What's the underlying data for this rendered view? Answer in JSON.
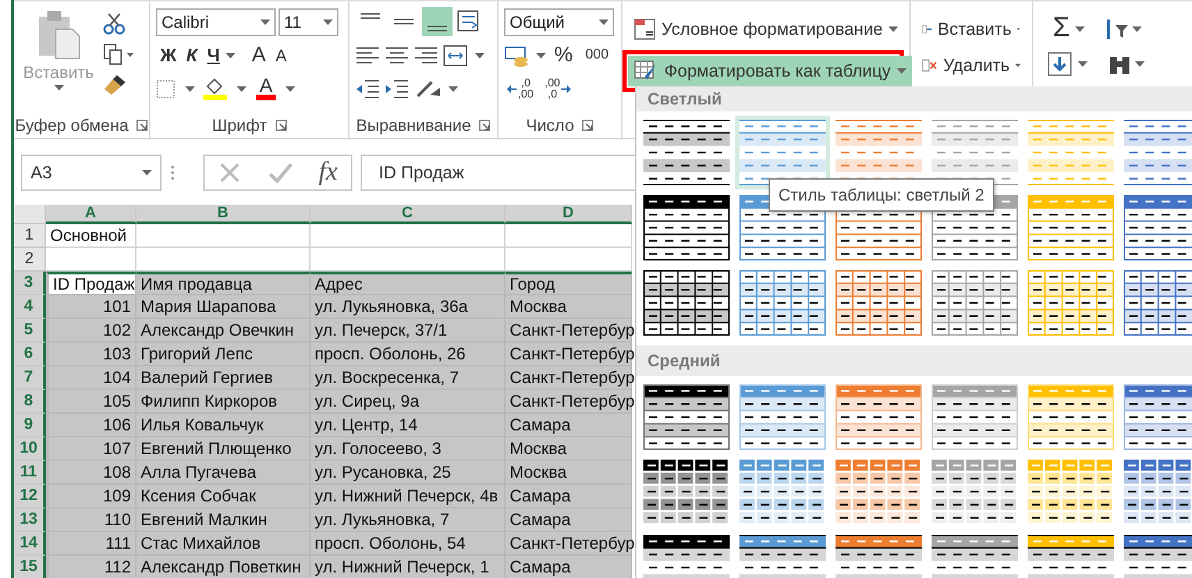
{
  "ribbon": {
    "clipboard": {
      "paste_label": "Вставить",
      "group_label": "Буфер обмена"
    },
    "font": {
      "font_name": "Calibri",
      "font_size": "11",
      "style_buttons": [
        {
          "kind": "bold",
          "label": "Ж"
        },
        {
          "kind": "italic",
          "label": "К"
        },
        {
          "kind": "underline",
          "label": "Ч"
        }
      ],
      "grow_label": "A",
      "shrink_label": "A",
      "font_color_label": "A",
      "group_label": "Шрифт"
    },
    "alignment": {
      "vertical_buttons": [
        {
          "kind": "top",
          "selected": false
        },
        {
          "kind": "middle",
          "selected": false
        },
        {
          "kind": "bottom",
          "selected": true
        }
      ],
      "group_label": "Выравнивание"
    },
    "number": {
      "format": "Общий",
      "percent": "%",
      "thousands": "000",
      "decimal_buttons": [
        {
          "kind": "increase",
          "lines": [
            ",0",
            ",00"
          ]
        },
        {
          "kind": "decrease",
          "lines": [
            ",00",
            ",0"
          ]
        }
      ],
      "group_label": "Число"
    },
    "styles": {
      "conditional": "Условное форматирование",
      "format_as_table": {
        "label": "Форматировать как таблицу",
        "pressed": true
      }
    },
    "cells": {
      "insert": "Вставить",
      "delete": "Удалить"
    },
    "editing": {
      "sum": "Σ"
    }
  },
  "formula_bar": {
    "name_box": "A3",
    "fx": "fx",
    "formula": "ID Продаж"
  },
  "sheet": {
    "columns": [
      {
        "label": "A",
        "selected": true
      },
      {
        "label": "B",
        "selected": true
      },
      {
        "label": "C",
        "selected": true
      },
      {
        "label": "D",
        "selected": true
      }
    ],
    "rows": [
      {
        "number": "1",
        "selected": false,
        "active": false,
        "cells": [
          "Основной"
        ]
      },
      {
        "number": "2",
        "selected": false,
        "active": false
      },
      {
        "number": "3",
        "selected": true,
        "active": true,
        "cells": [
          "ID Продаж",
          "Имя продавца",
          "Адрес",
          "Город"
        ]
      },
      {
        "number": "4",
        "selected": true,
        "active": false,
        "cells": [
          "101",
          "Мария Шарапова",
          "ул. Лукьяновка, 36а",
          "Москва"
        ]
      },
      {
        "number": "5",
        "selected": true,
        "active": false,
        "cells": [
          "102",
          "Александр Овечкин",
          "ул. Печерск, 37/1",
          "Санкт-Петербур"
        ]
      },
      {
        "number": "6",
        "selected": true,
        "active": false,
        "cells": [
          "103",
          "Григорий Лепс",
          "просп. Оболонь, 26",
          "Санкт-Петербур"
        ]
      },
      {
        "number": "7",
        "selected": true,
        "active": false,
        "cells": [
          "104",
          "Валерий Гергиев",
          "ул. Воскресенка, 7",
          "Санкт-Петербур"
        ]
      },
      {
        "number": "8",
        "selected": true,
        "active": false,
        "cells": [
          "105",
          "Филипп Киркоров",
          "ул. Сирец, 9а",
          "Санкт-Петербур"
        ]
      },
      {
        "number": "9",
        "selected": true,
        "active": false,
        "cells": [
          "106",
          "Илья Ковальчук",
          "ул. Центр, 14",
          "Самара"
        ]
      },
      {
        "number": "10",
        "selected": true,
        "active": false,
        "cells": [
          "107",
          "Евгений Плющенко",
          "ул. Голосеево, 3",
          "Москва"
        ]
      },
      {
        "number": "11",
        "selected": true,
        "active": false,
        "cells": [
          "108",
          "Алла Пугачева",
          "ул. Русановка, 25",
          "Москва"
        ]
      },
      {
        "number": "12",
        "selected": true,
        "active": false,
        "cells": [
          "109",
          "Ксения Собчак",
          "ул. Нижний Печерск, 4в",
          "Самара"
        ]
      },
      {
        "number": "13",
        "selected": true,
        "active": false,
        "cells": [
          "110",
          "Евгений Малкин",
          "ул. Лукьяновка, 7",
          "Самара"
        ]
      },
      {
        "number": "14",
        "selected": true,
        "active": false,
        "cells": [
          "111",
          "Стас Михайлов",
          "просп. Оболонь, 54",
          "Санкт-Петербур"
        ]
      },
      {
        "number": "15",
        "selected": true,
        "active": false,
        "cells": [
          "112",
          "Александр Поветкин",
          "ул. Нижний Печерск, 1",
          "Самара"
        ]
      }
    ]
  },
  "gallery": {
    "tooltip": "Стиль таблицы: светлый 2",
    "sections": [
      {
        "title": "Светлый",
        "rows": [
          {
            "kind": "light-banded",
            "styles": [
              {
                "color": "#000000",
                "selected": false
              },
              {
                "color": "#5b9bd5",
                "selected": true
              },
              {
                "color": "#ed7d31",
                "selected": false
              },
              {
                "color": "#a5a5a5",
                "selected": false
              },
              {
                "color": "#ffc000",
                "selected": false
              },
              {
                "color": "#4472c4",
                "selected": false
              }
            ]
          },
          {
            "kind": "light-header",
            "styles": [
              {
                "color": "#000000",
                "selected": false
              },
              {
                "color": "#5b9bd5",
                "selected": false
              },
              {
                "color": "#ed7d31",
                "selected": false
              },
              {
                "color": "#a5a5a5",
                "selected": false
              },
              {
                "color": "#ffc000",
                "selected": false
              },
              {
                "color": "#4472c4",
                "selected": false
              }
            ]
          },
          {
            "kind": "light-grid",
            "styles": [
              {
                "color": "#000000",
                "selected": false
              },
              {
                "color": "#5b9bd5",
                "selected": false
              },
              {
                "color": "#ed7d31",
                "selected": false
              },
              {
                "color": "#a5a5a5",
                "selected": false
              },
              {
                "color": "#ffc000",
                "selected": false
              },
              {
                "color": "#4472c4",
                "selected": false
              }
            ]
          }
        ]
      },
      {
        "title": "Средний",
        "rows": [
          {
            "kind": "medium-banded",
            "styles": [
              {
                "color": "#000000",
                "selected": false
              },
              {
                "color": "#5b9bd5",
                "selected": false
              },
              {
                "color": "#ed7d31",
                "selected": false
              },
              {
                "color": "#a5a5a5",
                "selected": false
              },
              {
                "color": "#ffc000",
                "selected": false
              },
              {
                "color": "#4472c4",
                "selected": false
              }
            ]
          },
          {
            "kind": "medium-grid",
            "styles": [
              {
                "color": "#000000",
                "selected": false
              },
              {
                "color": "#5b9bd5",
                "selected": false
              },
              {
                "color": "#ed7d31",
                "selected": false
              },
              {
                "color": "#a5a5a5",
                "selected": false
              },
              {
                "color": "#ffc000",
                "selected": false
              },
              {
                "color": "#4472c4",
                "selected": false
              }
            ]
          },
          {
            "kind": "medium-header",
            "styles": [
              {
                "color": "#000000",
                "selected": false
              },
              {
                "color": "#5b9bd5",
                "selected": false
              },
              {
                "color": "#ed7d31",
                "selected": false
              },
              {
                "color": "#a5a5a5",
                "selected": false
              },
              {
                "color": "#ffc000",
                "selected": false
              },
              {
                "color": "#4472c4",
                "selected": false
              }
            ]
          }
        ]
      }
    ]
  }
}
